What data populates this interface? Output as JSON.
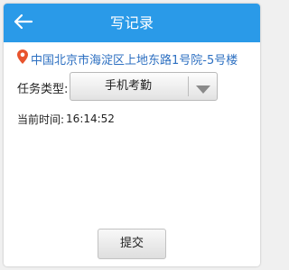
{
  "header": {
    "title": "写记录",
    "back_icon": "back-arrow-icon",
    "background": "#2a9ae8"
  },
  "location": {
    "icon": "map-pin-icon",
    "icon_color": "#e8542e",
    "text": "中国北京市海淀区上地东路1号院-5号楼",
    "text_color": "#2c6fc1"
  },
  "task": {
    "label": "任务类型:",
    "selected": "手机考勤",
    "arrow_icon": "dropdown-triangle-icon"
  },
  "time": {
    "label": "当前时间:",
    "value": "16:14:52"
  },
  "actions": {
    "submit_label": "提交"
  }
}
